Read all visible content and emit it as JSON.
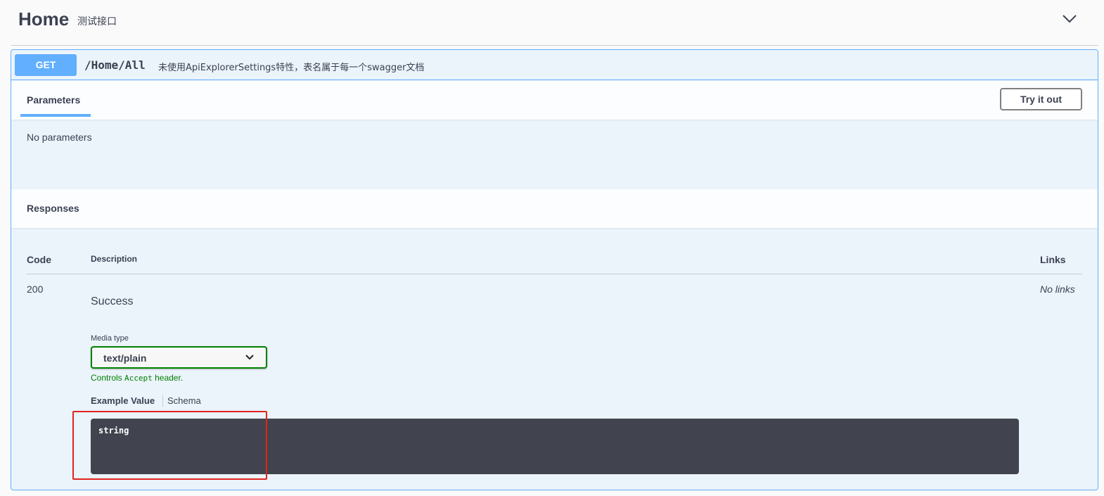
{
  "tag": {
    "title": "Home",
    "description": "测试接口"
  },
  "operation": {
    "method": "GET",
    "path": "/Home/All",
    "summary": "未使用ApiExplorerSettings特性，表名属于每一个swagger文档",
    "method_color": "#61affe"
  },
  "parameters": {
    "tab_label": "Parameters",
    "try_button_label": "Try it out",
    "empty_text": "No parameters"
  },
  "responses": {
    "header": "Responses",
    "columns": {
      "code": "Code",
      "description": "Description",
      "links": "Links"
    },
    "rows": [
      {
        "code": "200",
        "description": "Success",
        "links": "No links",
        "media_type_label": "Media type",
        "media_type_value": "text/plain",
        "controls_prefix": "Controls ",
        "controls_code": "Accept",
        "controls_suffix": " header.",
        "example_tab": "Example Value",
        "schema_tab": "Schema",
        "example_value": "string"
      }
    ]
  },
  "icons": {
    "collapse": "chevron-down-icon",
    "select": "chevron-down-icon"
  },
  "colors": {
    "get_accent": "#61affe",
    "media_border": "#008000",
    "highlight": "#e0241b",
    "example_bg": "#41444e"
  }
}
